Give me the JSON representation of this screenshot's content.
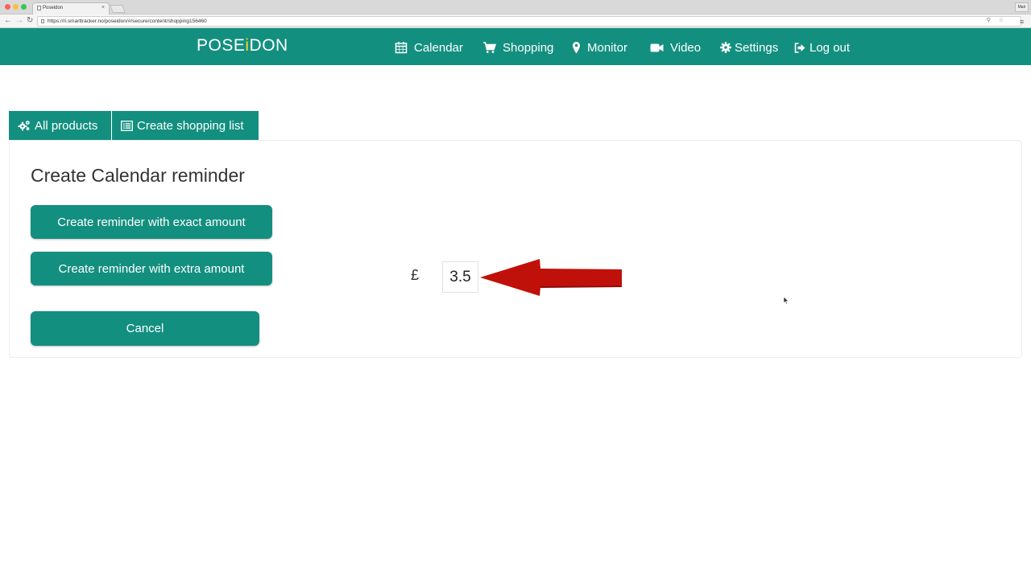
{
  "browser": {
    "tab_title": "Poseidon",
    "url": "https://ri.smarttracker.no/poseidon/#/secure/content/shopping156460",
    "profile": "Mari"
  },
  "nav": {
    "logo_prefix": "POSE",
    "logo_accent": "i",
    "logo_suffix": "DON",
    "items": [
      {
        "label": "Calendar",
        "icon": "calendar-icon"
      },
      {
        "label": "Shopping",
        "icon": "cart-icon"
      },
      {
        "label": "Monitor",
        "icon": "map-marker-icon"
      },
      {
        "label": "Video",
        "icon": "video-camera-icon"
      },
      {
        "label": "Settings",
        "icon": "gear-icon"
      },
      {
        "label": "Log out",
        "icon": "sign-out-icon"
      }
    ]
  },
  "tabs": [
    {
      "label": "All products",
      "icon": "gears-icon"
    },
    {
      "label": "Create shopping list",
      "icon": "list-icon"
    }
  ],
  "panel": {
    "title": "Create Calendar reminder",
    "exact_button": "Create reminder with exact amount",
    "extra_button": "Create reminder with extra amount",
    "cancel_button": "Cancel",
    "currency_symbol": "£",
    "amount_value": "3.5"
  },
  "colors": {
    "brand": "#138f80",
    "logo_accent": "#f5d81e",
    "arrow": "#c0100a"
  }
}
